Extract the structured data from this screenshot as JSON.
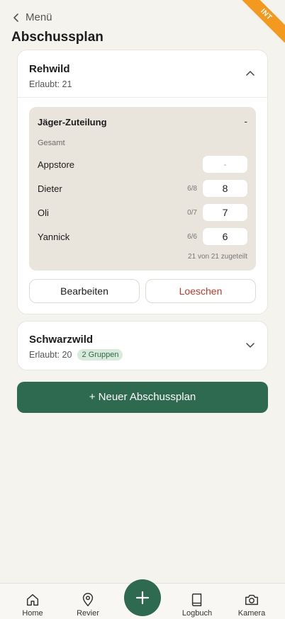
{
  "env_badge": "INT",
  "nav": {
    "back_label": "Menü"
  },
  "page_title": "Abschussplan",
  "plans": [
    {
      "title": "Rehwild",
      "allowed": "Erlaubt: 21",
      "expanded": true,
      "allocation": {
        "title": "Jäger-Zuteilung",
        "toggle": "-",
        "total_label": "Gesamt",
        "rows": [
          {
            "name": "Appstore",
            "ratio": "",
            "value": "-"
          },
          {
            "name": "Dieter",
            "ratio": "6/8",
            "value": "8"
          },
          {
            "name": "Oli",
            "ratio": "0/7",
            "value": "7"
          },
          {
            "name": "Yannick",
            "ratio": "6/6",
            "value": "6"
          }
        ],
        "summary": "21 von 21 zugeteilt"
      },
      "edit_label": "Bearbeiten",
      "delete_label": "Loeschen"
    },
    {
      "title": "Schwarzwild",
      "allowed": "Erlaubt: 20",
      "badge": "2 Gruppen",
      "expanded": false
    }
  ],
  "new_plan_label": "+ Neuer Abschussplan",
  "tabs": [
    {
      "label": "Home",
      "icon": "home-icon"
    },
    {
      "label": "Revier",
      "icon": "map-pin-icon"
    },
    {
      "label": "Logbuch",
      "icon": "book-icon"
    },
    {
      "label": "Kamera",
      "icon": "camera-icon"
    }
  ],
  "colors": {
    "background": "#f5f3ee",
    "accent": "#2e6a4f",
    "danger": "#c0392b",
    "badge_bg": "#d7eadb",
    "ribbon": "#f39a1e"
  }
}
